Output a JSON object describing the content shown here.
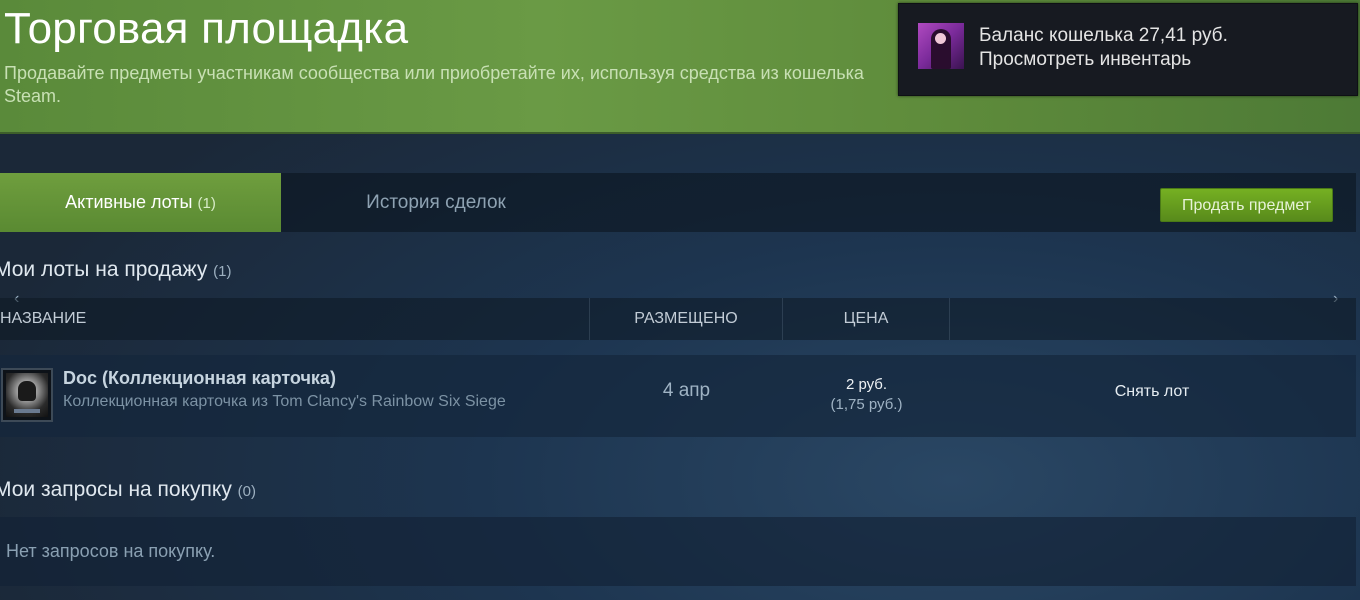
{
  "header": {
    "title": "Торговая площадка",
    "subtitle": "Продавайте предметы участникам сообщества или приобретайте их, используя средства из кошелька Steam."
  },
  "wallet": {
    "balance_label": "Баланс кошелька 27,41 руб.",
    "inventory_link": "Просмотреть инвентарь"
  },
  "tabs": {
    "active_label": "Активные лоты",
    "active_count": "(1)",
    "history_label": "История сделок",
    "sell_button": "Продать предмет"
  },
  "listings": {
    "title": "Мои лоты на продажу",
    "count": "(1)",
    "columns": [
      "НАЗВАНИЕ",
      "РАЗМЕЩЕНО",
      "ЦЕНА"
    ],
    "rows": [
      {
        "name": "Doc (Коллекционная карточка)",
        "game": "Коллекционная карточка из Tom Clancy's Rainbow Six Siege",
        "listed_on": "4 апр",
        "price": "2 руб.",
        "price_net": "(1,75 руб.)",
        "remove_label": "Снять лот"
      }
    ]
  },
  "buy_requests": {
    "title": "Мои запросы на покупку",
    "count": "(0)",
    "empty_text": "Нет запросов на покупку."
  },
  "icons": {
    "prev": "‹",
    "next": "›"
  }
}
